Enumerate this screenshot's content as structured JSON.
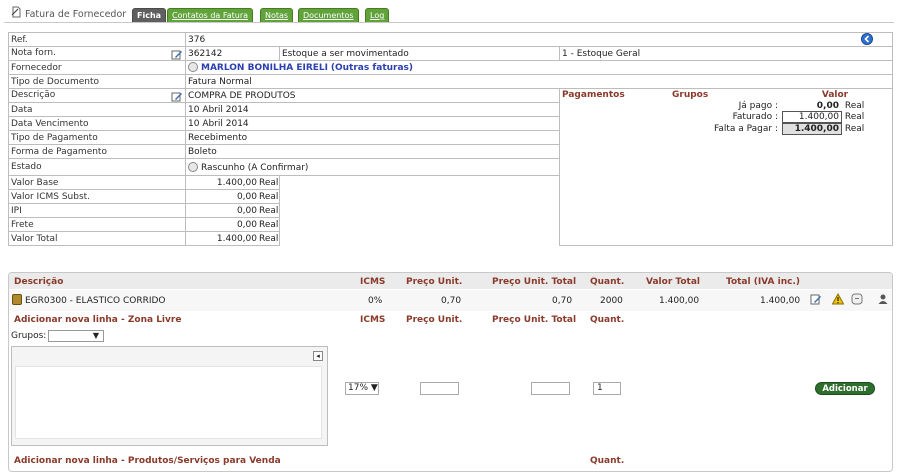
{
  "header": {
    "page_title": "Fatura de Fornecedor",
    "tabs": [
      {
        "label": "Ficha",
        "active": true
      },
      {
        "label": "Contatos da Fatura",
        "active": false
      },
      {
        "label": "Notas",
        "active": false
      },
      {
        "label": "Documentos",
        "active": false
      },
      {
        "label": "Log",
        "active": false
      }
    ]
  },
  "ficha": {
    "ref_label": "Ref.",
    "ref_value": "376",
    "nota_label": "Nota forn.",
    "nota_value": "362142",
    "stock_text": "Estoque a ser movimentado",
    "stock_value": "1 - Estoque Geral",
    "fornecedor_label": "Fornecedor",
    "fornecedor_name": "MARLON BONILHA EIRELI",
    "fornecedor_link": "(Outras faturas)",
    "tipo_doc_label": "Tipo de Documento",
    "tipo_doc_value": "Fatura Normal",
    "descricao_label": "Descrição",
    "descricao_value": "COMPRA DE PRODUTOS",
    "data_label": "Data",
    "data_value": "10 Abril 2014",
    "vencimento_label": "Data Vencimento",
    "vencimento_value": "10 Abril 2014",
    "tipo_pag_label": "Tipo de Pagamento",
    "tipo_pag_value": "Recebimento",
    "forma_pag_label": "Forma de Pagamento",
    "forma_pag_value": "Boleto",
    "estado_label": "Estado",
    "estado_value": "Rascunho (A Confirmar)",
    "valor_base_label": "Valor Base",
    "valor_base_value": "1.400,00",
    "icms_subst_label": "Valor ICMS Subst.",
    "icms_subst_value": "0,00",
    "ipi_label": "IPI",
    "ipi_value": "0,00",
    "frete_label": "Frete",
    "frete_value": "0,00",
    "valor_total_label": "Valor Total",
    "valor_total_value": "1.400,00",
    "currency": "Real"
  },
  "payments": {
    "col_pagamentos": "Pagamentos",
    "col_grupos": "Grupos",
    "col_valor": "Valor",
    "ja_pago_label": "Já pago :",
    "ja_pago_value": "0,00",
    "faturado_label": "Faturado :",
    "faturado_value": "1.400,00",
    "falta_label": "Falta a Pagar :",
    "falta_value": "1.400,00",
    "currency": "Real"
  },
  "lines": {
    "headers": {
      "descricao": "Descrição",
      "icms": "ICMS",
      "preco_unit": "Preço Unit.",
      "preco_unit_total": "Preço Unit. Total",
      "quant": "Quant.",
      "valor_total": "Valor Total",
      "total_iva": "Total (IVA inc.)"
    },
    "items": [
      {
        "description": "EGR0300 - ELASTICO CORRIDO",
        "icms": "0%",
        "preco_unit": "0,70",
        "preco_unit_total": "0,70",
        "quant": "2000",
        "valor_total": "1.400,00",
        "total_iva": "1.400,00"
      }
    ]
  },
  "add_free": {
    "title": "Adicionar nova linha - Zona Livre",
    "col_icms": "ICMS",
    "col_preco_unit": "Preço Unit.",
    "col_preco_unit_total": "Preço Unit. Total",
    "col_quant": "Quant.",
    "grupos_label": "Grupos:",
    "grupos_selected": "▼",
    "icms_selected": "17% ▼",
    "quant_value": "1",
    "add_button": "Adicionar",
    "panel_button": "◂"
  },
  "add_products": {
    "title": "Adicionar nova linha - Produtos/Serviços para Venda",
    "col_quant": "Quant."
  },
  "colors": {
    "tab_green": "#5fa33a",
    "tab_active": "#5f5f5f",
    "header_brown": "#8a3a2a",
    "link_blue": "#2b3fb0",
    "button_green": "#2d6e2d"
  },
  "icons": [
    "page-icon",
    "back-icon",
    "edit-icon",
    "supplier-icon",
    "status-icon",
    "product-icon",
    "warning-icon",
    "info-icon",
    "user-icon"
  ]
}
